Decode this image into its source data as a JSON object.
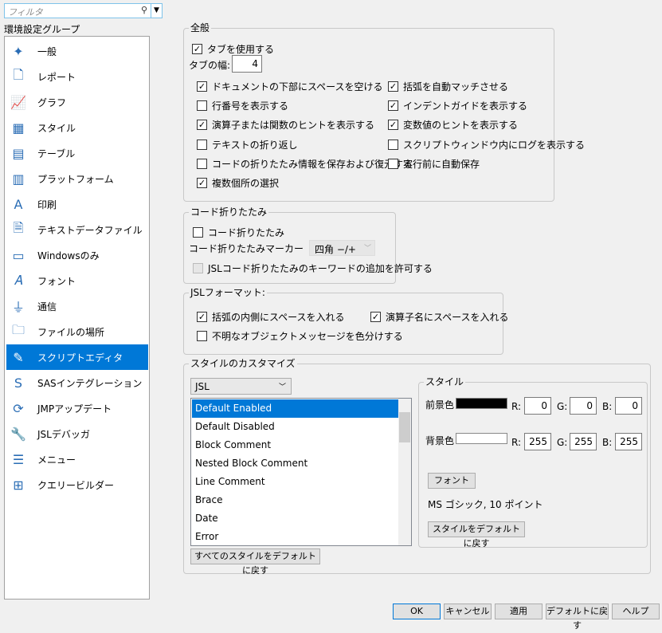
{
  "filter": {
    "placeholder": "フィルタ"
  },
  "sidebar": {
    "title": "環境設定グループ",
    "selected": 12,
    "items": [
      {
        "label": "一般",
        "icon": "jmp-person-icon"
      },
      {
        "label": "レポート",
        "icon": "report-icon"
      },
      {
        "label": "グラフ",
        "icon": "graph-icon"
      },
      {
        "label": "スタイル",
        "icon": "style-icon"
      },
      {
        "label": "テーブル",
        "icon": "table-icon"
      },
      {
        "label": "プラットフォーム",
        "icon": "platform-icon"
      },
      {
        "label": "印刷",
        "icon": "print-icon"
      },
      {
        "label": "テキストデータファイル",
        "icon": "txt-file-icon"
      },
      {
        "label": "Windowsのみ",
        "icon": "monitor-icon"
      },
      {
        "label": "フォント",
        "icon": "font-icon"
      },
      {
        "label": "通信",
        "icon": "plug-icon"
      },
      {
        "label": "ファイルの場所",
        "icon": "folder-icon"
      },
      {
        "label": "スクリプトエディタ",
        "icon": "script-icon"
      },
      {
        "label": "SASインテグレーション",
        "icon": "sas-icon"
      },
      {
        "label": "JMPアップデート",
        "icon": "update-icon"
      },
      {
        "label": "JSLデバッガ",
        "icon": "wrench-icon"
      },
      {
        "label": "メニュー",
        "icon": "menu-icon"
      },
      {
        "label": "クエリービルダー",
        "icon": "query-icon"
      }
    ]
  },
  "general": {
    "title": "全般",
    "use_tabs": {
      "label": "タブを使用する",
      "checked": true
    },
    "tab_width_label": "タブの幅:",
    "tab_width": "4",
    "left": [
      {
        "label": "ドキュメントの下部にスペースを空ける",
        "checked": true
      },
      {
        "label": "行番号を表示する",
        "checked": false
      },
      {
        "label": "演算子または関数のヒントを表示する",
        "checked": true
      },
      {
        "label": "テキストの折り返し",
        "checked": false
      },
      {
        "label": "コードの折りたたみ情報を保存および復元する",
        "checked": false
      },
      {
        "label": "複数個所の選択",
        "checked": true
      }
    ],
    "right": [
      {
        "label": "括弧を自動マッチさせる",
        "checked": true
      },
      {
        "label": "インデントガイドを表示する",
        "checked": true
      },
      {
        "label": "変数値のヒントを表示する",
        "checked": true
      },
      {
        "label": "スクリプトウィンドウ内にログを表示する",
        "checked": false
      },
      {
        "label": "実行前に自動保存",
        "checked": false
      }
    ]
  },
  "folding": {
    "title": "コード折りたたみ",
    "enable": {
      "label": "コード折りたたみ",
      "checked": false
    },
    "marker_label": "コード折りたたみマーカー",
    "marker_value": "四角 −/+",
    "keywords": {
      "label": "JSLコード折りたたみのキーワードの追加を許可する",
      "checked": false
    }
  },
  "format": {
    "title": "JSLフォーマット:",
    "items": [
      {
        "label": "括弧の内側にスペースを入れる",
        "checked": true
      },
      {
        "label": "演算子名にスペースを入れる",
        "checked": true
      },
      {
        "label": "不明なオブジェクトメッセージを色分けする",
        "checked": false
      }
    ]
  },
  "custom": {
    "title": "スタイルのカスタマイズ",
    "language": "JSL",
    "styles": [
      "Default Enabled",
      "Default Disabled",
      "Block Comment",
      "Nested Block Comment",
      "Line Comment",
      "Brace",
      "Date",
      "Error"
    ],
    "selected": 0,
    "reset_all": "すべてのスタイルをデフォルトに戻す",
    "style": {
      "title": "スタイル",
      "fg_label": "前景色",
      "bg_label": "背景色",
      "fg_color": "#000000",
      "bg_color": "#ffffff",
      "fg": {
        "r": "0",
        "g": "0",
        "b": "0"
      },
      "bg": {
        "r": "255",
        "g": "255",
        "b": "255"
      },
      "r": "R:",
      "g": "G:",
      "b": "B:",
      "font_button": "フォント",
      "font_desc": "MS ゴシック, 10 ポイント",
      "reset": "スタイルをデフォルトに戻す"
    }
  },
  "buttons": {
    "ok": "OK",
    "cancel": "キャンセル",
    "apply": "適用",
    "defaults": "デフォルトに戻す",
    "help": "ヘルプ"
  }
}
